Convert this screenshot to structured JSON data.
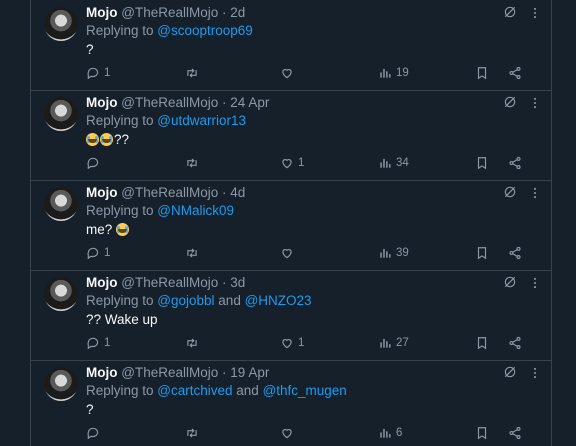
{
  "tweets": [
    {
      "name": "Mojo",
      "handle": "@TheReallMojo",
      "dot": "·",
      "time": "2d",
      "replying_prefix": "Replying to ",
      "mentions": [
        "@scooptroop69"
      ],
      "mention_joiner": "",
      "body_text": "?",
      "emojis": 0,
      "body_suffix": "",
      "replies": "1",
      "retweets": "",
      "likes": "",
      "views": "19"
    },
    {
      "name": "Mojo",
      "handle": "@TheReallMojo",
      "dot": "·",
      "time": "24 Apr",
      "replying_prefix": "Replying to ",
      "mentions": [
        "@utdwarrior13"
      ],
      "mention_joiner": "",
      "body_text": "",
      "emojis": 2,
      "body_suffix": "??",
      "replies": "",
      "retweets": "",
      "likes": "1",
      "views": "34"
    },
    {
      "name": "Mojo",
      "handle": "@TheReallMojo",
      "dot": "·",
      "time": "4d",
      "replying_prefix": "Replying to ",
      "mentions": [
        "@NMalick09"
      ],
      "mention_joiner": "",
      "body_text": "me? ",
      "emojis": 1,
      "body_suffix": "",
      "replies": "1",
      "retweets": "",
      "likes": "",
      "views": "39"
    },
    {
      "name": "Mojo",
      "handle": "@TheReallMojo",
      "dot": "·",
      "time": "3d",
      "replying_prefix": "Replying to ",
      "mentions": [
        "@gojobbl",
        "@HNZO23"
      ],
      "mention_joiner": " and ",
      "body_text": "?? Wake up",
      "emojis": 0,
      "body_suffix": "",
      "replies": "1",
      "retweets": "",
      "likes": "1",
      "views": "27"
    },
    {
      "name": "Mojo",
      "handle": "@TheReallMojo",
      "dot": "·",
      "time": "19 Apr",
      "replying_prefix": "Replying to ",
      "mentions": [
        "@cartchived",
        "@thfc_mugen"
      ],
      "mention_joiner": " and ",
      "body_text": "?",
      "emojis": 0,
      "body_suffix": "",
      "replies": "",
      "retweets": "",
      "likes": "",
      "views": "6"
    }
  ],
  "icons": {
    "reply": "reply-icon",
    "retweet": "retweet-icon",
    "like": "heart-icon",
    "views": "views-icon",
    "bookmark": "bookmark-icon",
    "share": "share-icon",
    "grok": "grok-icon",
    "more": "more-icon"
  },
  "colors": {
    "background": "#15202b",
    "text": "#f7f9f9",
    "muted": "#8b98a5",
    "accent": "#1d9bf0",
    "border": "#38444d"
  }
}
